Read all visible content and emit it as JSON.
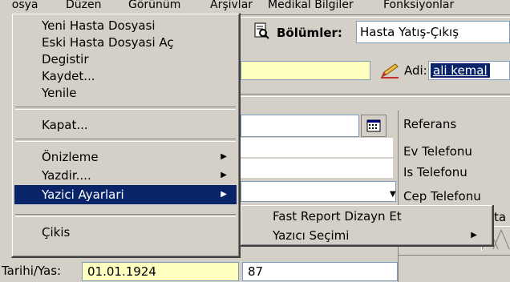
{
  "menubar": {
    "items": [
      "Dosya",
      "Düzen",
      "Görünüm",
      "Arşivlar",
      "Medikal Bilgiler",
      "Fonksiyonlar"
    ]
  },
  "toolbar": {
    "bolumler_label": "Bölümler:",
    "bolumler_value": "Hasta Yatış-Çıkış"
  },
  "patient": {
    "adi_label": "Adi:",
    "adi_value": "ali kemal",
    "tarih_label": "Tarihi/Yas:",
    "tarih_value": "01.01.1924",
    "yas_value": "87"
  },
  "right_panel": {
    "labels": [
      "Referans",
      "Ev Telefonu",
      "Is Telefonu",
      "Cep Telefonu",
      "ta"
    ]
  },
  "file_menu": {
    "items": [
      {
        "label": "Yeni  Hasta Dosyasi"
      },
      {
        "label": "Eski Hasta Dosyasi Aç"
      },
      {
        "label": "Degistir"
      },
      {
        "label": "Kaydet..."
      },
      {
        "label": "Yenile"
      },
      {
        "label": "Kapat..."
      },
      {
        "label": "Önizleme"
      },
      {
        "label": "Yazdir...."
      },
      {
        "label": "Yazici Ayarlari"
      },
      {
        "label": "Çikis"
      }
    ]
  },
  "submenu": {
    "items": [
      {
        "label": "Fast Report Dizayn Et"
      },
      {
        "label": "Yazıcı Seçimi"
      }
    ]
  },
  "colors": {
    "selection": "#0a246a",
    "menu_bg": "#d4d0c8",
    "highlight_field": "#ffffc0"
  }
}
